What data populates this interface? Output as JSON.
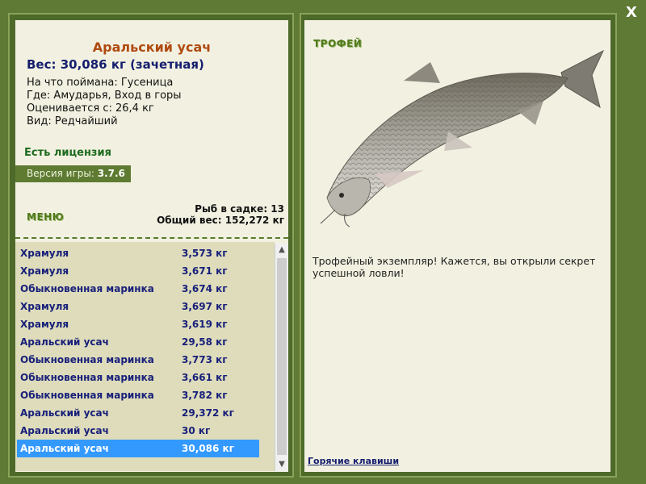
{
  "close_label": "X",
  "catch": {
    "title": "Аральский усач",
    "weight_line": "Вес: 30,086 кг (зачетная)",
    "caught_on": "На что поймана: Гусеница",
    "where": "Где: Амударья, Вход в горы",
    "valued_from": "Оценивается с: 26,4 кг",
    "kind": "Вид: Редчайший"
  },
  "license": "Есть лицензия",
  "version": {
    "label": "Версия игры:",
    "value": "3.7.6"
  },
  "menu_label": "МЕНЮ",
  "stats": {
    "count": "Рыб в садке: 13",
    "total": "Общий вес: 152,272 кг"
  },
  "fish_list": [
    {
      "name": "Храмуля",
      "weight": "3,573 кг"
    },
    {
      "name": "Храмуля",
      "weight": "3,671 кг"
    },
    {
      "name": "Обыкновенная маринка",
      "weight": "3,674 кг"
    },
    {
      "name": "Храмуля",
      "weight": "3,697 кг"
    },
    {
      "name": "Храмуля",
      "weight": "3,619 кг"
    },
    {
      "name": "Аральский усач",
      "weight": "29,58 кг"
    },
    {
      "name": "Обыкновенная маринка",
      "weight": "3,773 кг"
    },
    {
      "name": "Обыкновенная маринка",
      "weight": "3,661 кг"
    },
    {
      "name": "Обыкновенная маринка",
      "weight": "3,782 кг"
    },
    {
      "name": "Аральский усач",
      "weight": "29,372 кг"
    },
    {
      "name": "Аральский усач",
      "weight": "30 кг"
    },
    {
      "name": "Аральский усач",
      "weight": "30,086 кг"
    }
  ],
  "selected_index": 11,
  "trophy_label": "ТРОФЕЙ",
  "trophy_text": "Трофейный экземпляр! Кажется, вы открыли секрет успешной ловли!",
  "hotkeys_label": "Горячие клавиши",
  "colors": {
    "frame": "#5f7a34",
    "panel": "#f2f1e1",
    "selected": "#3399ff",
    "list_bg": "#dedcbb"
  }
}
